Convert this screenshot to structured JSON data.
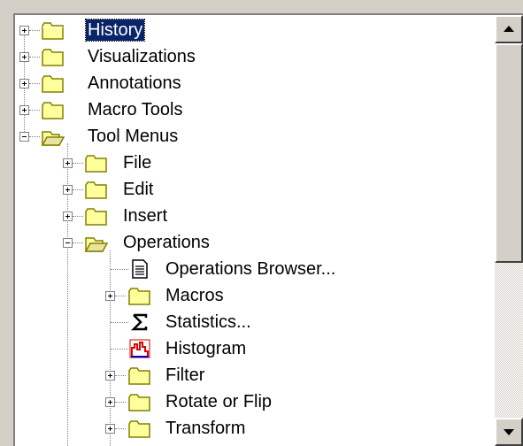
{
  "tree": {
    "items": [
      {
        "label": "History",
        "expander": "plus",
        "icon": "folder-closed-icon",
        "selected": true
      },
      {
        "label": "Visualizations",
        "expander": "plus",
        "icon": "folder-closed-icon"
      },
      {
        "label": "Annotations",
        "expander": "plus",
        "icon": "folder-closed-icon"
      },
      {
        "label": "Macro Tools",
        "expander": "plus",
        "icon": "folder-closed-icon"
      },
      {
        "label": "Tool Menus",
        "expander": "minus",
        "icon": "folder-open-icon"
      },
      {
        "label": "File",
        "expander": "plus",
        "icon": "folder-closed-icon"
      },
      {
        "label": "Edit",
        "expander": "plus",
        "icon": "folder-closed-icon"
      },
      {
        "label": "Insert",
        "expander": "plus",
        "icon": "folder-closed-icon"
      },
      {
        "label": "Operations",
        "expander": "minus",
        "icon": "folder-open-icon"
      },
      {
        "label": "Operations Browser...",
        "icon": "document-icon"
      },
      {
        "label": "Macros",
        "expander": "plus",
        "icon": "folder-closed-icon"
      },
      {
        "label": "Statistics...",
        "icon": "sigma-icon"
      },
      {
        "label": "Histogram",
        "icon": "histogram-icon"
      },
      {
        "label": "Filter",
        "expander": "plus",
        "icon": "folder-closed-icon"
      },
      {
        "label": "Rotate or Flip",
        "expander": "plus",
        "icon": "folder-closed-icon"
      },
      {
        "label": "Transform",
        "expander": "plus",
        "icon": "folder-closed-icon"
      }
    ]
  },
  "colors": {
    "selection": "#0a246a",
    "folder_fill": "#fffe9c",
    "folder_edge": "#808000"
  },
  "scrollbar": {
    "up_icon": "triangle-up-icon",
    "down_icon": "triangle-down-icon"
  }
}
